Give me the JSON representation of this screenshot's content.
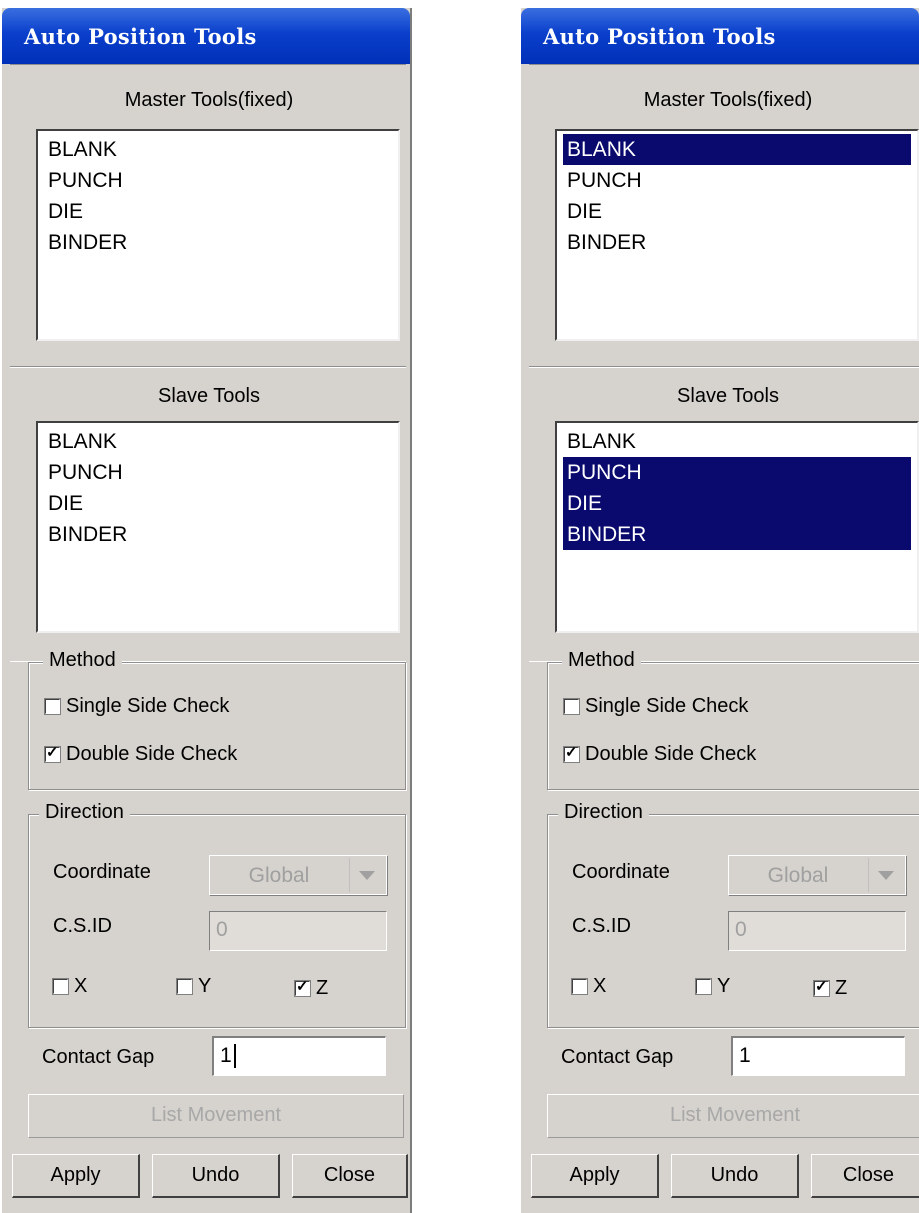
{
  "panels": [
    {
      "title": "Auto Position Tools",
      "master": {
        "label": "Master Tools(fixed)",
        "items": [
          "BLANK",
          "PUNCH",
          "DIE",
          "BINDER"
        ],
        "selected": []
      },
      "slave": {
        "label": "Slave Tools",
        "items": [
          "BLANK",
          "PUNCH",
          "DIE",
          "BINDER"
        ],
        "selected": []
      },
      "method": {
        "label": "Method",
        "single_label": "Single Side Check",
        "single_checked": false,
        "double_label": "Double Side Check",
        "double_checked": true
      },
      "direction": {
        "label": "Direction",
        "coordinate_label": "Coordinate",
        "coordinate_value": "Global",
        "csid_label": "C.S.ID",
        "csid_value": "0",
        "x_label": "X",
        "x_checked": false,
        "y_label": "Y",
        "y_checked": false,
        "z_label": "Z",
        "z_checked": true
      },
      "contact_gap": {
        "label": "Contact Gap",
        "value": "1",
        "caret": true
      },
      "list_movement_label": "List Movement",
      "buttons": {
        "apply": "Apply",
        "undo": "Undo",
        "close": "Close"
      }
    },
    {
      "title": "Auto Position Tools",
      "master": {
        "label": "Master Tools(fixed)",
        "items": [
          "BLANK",
          "PUNCH",
          "DIE",
          "BINDER"
        ],
        "selected": [
          "BLANK"
        ]
      },
      "slave": {
        "label": "Slave Tools",
        "items": [
          "BLANK",
          "PUNCH",
          "DIE",
          "BINDER"
        ],
        "selected": [
          "PUNCH",
          "DIE",
          "BINDER"
        ]
      },
      "method": {
        "label": "Method",
        "single_label": "Single Side Check",
        "single_checked": false,
        "double_label": "Double Side Check",
        "double_checked": true
      },
      "direction": {
        "label": "Direction",
        "coordinate_label": "Coordinate",
        "coordinate_value": "Global",
        "csid_label": "C.S.ID",
        "csid_value": "0",
        "x_label": "X",
        "x_checked": false,
        "y_label": "Y",
        "y_checked": false,
        "z_label": "Z",
        "z_checked": true
      },
      "contact_gap": {
        "label": "Contact Gap",
        "value": "1",
        "caret": false
      },
      "list_movement_label": "List Movement",
      "buttons": {
        "apply": "Apply",
        "undo": "Undo",
        "close": "Close"
      }
    }
  ]
}
